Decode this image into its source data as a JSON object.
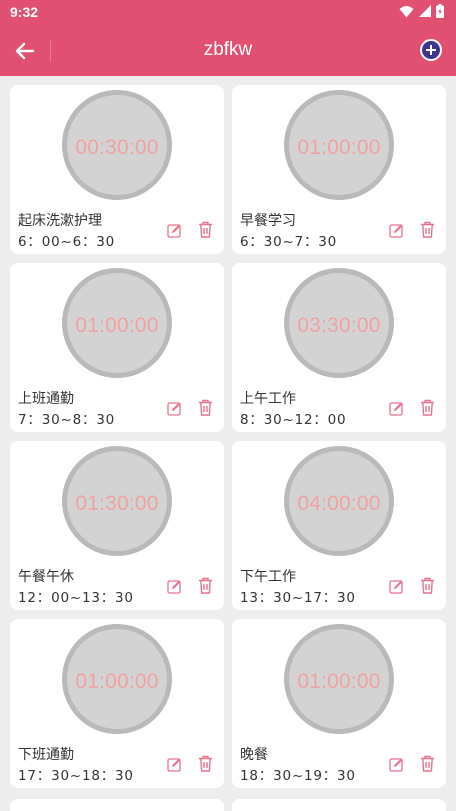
{
  "status_bar": {
    "time": "9:32"
  },
  "header": {
    "title": "zbfkw"
  },
  "colors": {
    "accent": "#e14f71",
    "add_button": "#3d3690",
    "dial_text": "#f2a1a1",
    "action_icon": "#e8718c"
  },
  "items": [
    {
      "duration": "00:30:00",
      "name": "起床洗漱护理",
      "time_range": "6：00~6：30"
    },
    {
      "duration": "01:00:00",
      "name": "早餐学习",
      "time_range": "6：30~7：30"
    },
    {
      "duration": "01:00:00",
      "name": "上班通勤",
      "time_range": "7：30~8：30"
    },
    {
      "duration": "03:30:00",
      "name": "上午工作",
      "time_range": "8：30~12：00"
    },
    {
      "duration": "01:30:00",
      "name": "午餐午休",
      "time_range": "12：00~13：30"
    },
    {
      "duration": "04:00:00",
      "name": "下午工作",
      "time_range": "13：30~17：30"
    },
    {
      "duration": "01:00:00",
      "name": "下班通勤",
      "time_range": "17：30~18：30"
    },
    {
      "duration": "01:00:00",
      "name": "晚餐",
      "time_range": "18：30~19：30"
    }
  ]
}
